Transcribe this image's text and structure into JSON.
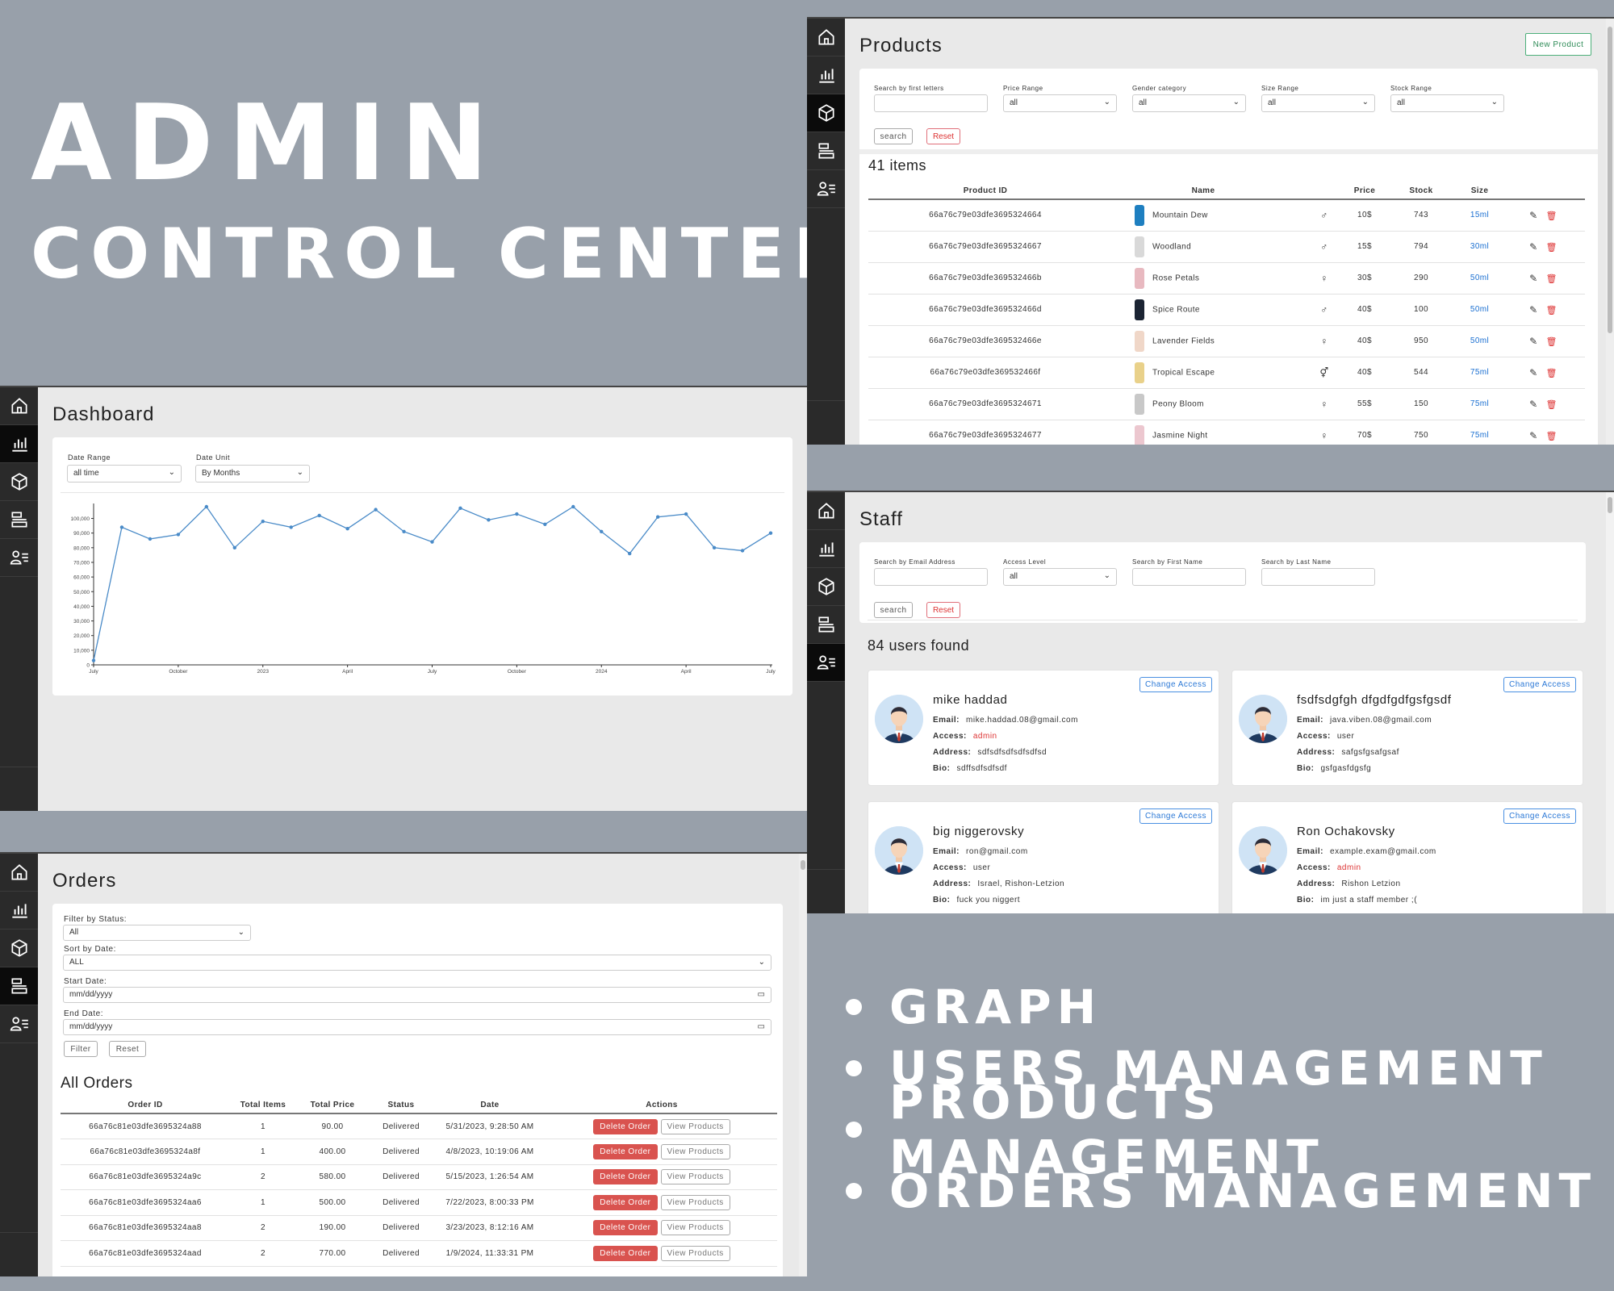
{
  "hero": {
    "title": "ADMIN",
    "subtitle": "CONTROL CENTER"
  },
  "features": [
    "GRAPH",
    "USERS MANAGEMENT",
    "PRODUCTS MANAGEMENT",
    "ORDERS MANAGEMENT"
  ],
  "dashboard": {
    "title": "Dashboard",
    "date_range_label": "Date Range",
    "date_range_value": "all time",
    "date_unit_label": "Date Unit",
    "date_unit_value": "By Months"
  },
  "chart_data": {
    "type": "line",
    "x_tick_labels": [
      "July",
      "October",
      "2023",
      "April",
      "July",
      "October",
      "2024",
      "April",
      "July"
    ],
    "y_tick_labels": [
      "0",
      "10,000",
      "20,000",
      "30,000",
      "40,000",
      "50,000",
      "60,000",
      "70,000",
      "80,000",
      "90,000",
      "100,000"
    ],
    "ylim": [
      0,
      108000
    ],
    "values": [
      3000,
      94000,
      86000,
      89000,
      108000,
      80000,
      98000,
      94000,
      102000,
      93000,
      106000,
      91000,
      84000,
      107000,
      99000,
      103000,
      96000,
      108000,
      91000,
      76000,
      101000,
      103000,
      80000,
      78000,
      90000
    ],
    "color": "#4a8bc8",
    "grid": false
  },
  "products": {
    "title": "Products",
    "new_button": "New Product",
    "filters": [
      {
        "label": "Search by first letters",
        "value": ""
      },
      {
        "label": "Price Range",
        "value": "all"
      },
      {
        "label": "Gender category",
        "value": "all"
      },
      {
        "label": "Size Range",
        "value": "all"
      },
      {
        "label": "Stock Range",
        "value": "all"
      }
    ],
    "search_btn": "search",
    "reset_btn": "Reset",
    "count": "41 items",
    "columns": [
      "Product ID",
      "Name",
      "Price",
      "Stock",
      "Size"
    ],
    "rows": [
      {
        "id": "66a76c79e03dfe3695324664",
        "name": "Mountain Dew",
        "gender": "♂",
        "price": "10$",
        "stock": "743",
        "size": "15ml",
        "color": "#1e7fc0"
      },
      {
        "id": "66a76c79e03dfe3695324667",
        "name": "Woodland",
        "gender": "♂",
        "price": "15$",
        "stock": "794",
        "size": "30ml",
        "color": "#d9d9d9"
      },
      {
        "id": "66a76c79e03dfe369532466b",
        "name": "Rose Petals",
        "gender": "♀",
        "price": "30$",
        "stock": "290",
        "size": "50ml",
        "color": "#e8b9c0"
      },
      {
        "id": "66a76c79e03dfe369532466d",
        "name": "Spice Route",
        "gender": "♂",
        "price": "40$",
        "stock": "100",
        "size": "50ml",
        "color": "#1b2433"
      },
      {
        "id": "66a76c79e03dfe369532466e",
        "name": "Lavender Fields",
        "gender": "♀",
        "price": "40$",
        "stock": "950",
        "size": "50ml",
        "color": "#f0d7c8"
      },
      {
        "id": "66a76c79e03dfe369532466f",
        "name": "Tropical Escape",
        "gender": "⚥",
        "price": "40$",
        "stock": "544",
        "size": "75ml",
        "color": "#e9d18a"
      },
      {
        "id": "66a76c79e03dfe3695324671",
        "name": "Peony Bloom",
        "gender": "♀",
        "price": "55$",
        "stock": "150",
        "size": "75ml",
        "color": "#c8c8c8"
      },
      {
        "id": "66a76c79e03dfe3695324677",
        "name": "Jasmine Night",
        "gender": "♀",
        "price": "70$",
        "stock": "750",
        "size": "75ml",
        "color": "#ecc7cf"
      }
    ]
  },
  "staff": {
    "title": "Staff",
    "filters": [
      {
        "label": "Search by Email Address",
        "value": ""
      },
      {
        "label": "Access Level",
        "value": "all"
      },
      {
        "label": "Search by First Name",
        "value": ""
      },
      {
        "label": "Search by Last Name",
        "value": ""
      }
    ],
    "search_btn": "search",
    "reset_btn": "Reset",
    "count": "84 users found",
    "change_access": "Change Access",
    "field_labels": {
      "email": "Email:",
      "access": "Access:",
      "address": "Address:",
      "bio": "Bio:"
    },
    "users": [
      {
        "name": "mike haddad",
        "email": "mike.haddad.08@gmail.com",
        "access": "admin",
        "address": "sdfsdfsdfsdfsdfsd",
        "bio": "sdffsdfsdfsdf"
      },
      {
        "name": "fsdfsdgfgh dfgdfgdfgsfgsdf",
        "email": "java.viben.08@gmail.com",
        "access": "user",
        "address": "safgsfgsafgsaf",
        "bio": "gsfgasfdgsfg"
      },
      {
        "name": "big niggerovsky",
        "email": "ron@gmail.com",
        "access": "user",
        "address": "Israel, Rishon-Letzion",
        "bio": "fuck you niggert"
      },
      {
        "name": "Ron Ochakovsky",
        "email": "example.exam@gmail.com",
        "access": "admin",
        "address": "Rishon Letzion",
        "bio": "im just a staff member ;("
      }
    ]
  },
  "orders": {
    "title": "Orders",
    "filter_status_label": "Filter by Status:",
    "filter_status_value": "All",
    "sort_label": "Sort by Date:",
    "sort_value": "ALL",
    "start_label": "Start Date:",
    "start_value": "mm/dd/yyyy",
    "end_label": "End Date:",
    "end_value": "mm/dd/yyyy",
    "filter_btn": "Filter",
    "reset_btn": "Reset",
    "section_title": "All Orders",
    "columns": [
      "Order ID",
      "Total Items",
      "Total Price",
      "Status",
      "Date",
      "Actions"
    ],
    "delete_label": "Delete Order",
    "view_label": "View Products",
    "rows": [
      {
        "id": "66a76c81e03dfe3695324a88",
        "items": "1",
        "price": "90.00",
        "status": "Delivered",
        "date": "5/31/2023, 9:28:50 AM"
      },
      {
        "id": "66a76c81e03dfe3695324a8f",
        "items": "1",
        "price": "400.00",
        "status": "Delivered",
        "date": "4/8/2023, 10:19:06 AM"
      },
      {
        "id": "66a76c81e03dfe3695324a9c",
        "items": "2",
        "price": "580.00",
        "status": "Delivered",
        "date": "5/15/2023, 1:26:54 AM"
      },
      {
        "id": "66a76c81e03dfe3695324aa6",
        "items": "1",
        "price": "500.00",
        "status": "Delivered",
        "date": "7/22/2023, 8:00:33 PM"
      },
      {
        "id": "66a76c81e03dfe3695324aa8",
        "items": "2",
        "price": "190.00",
        "status": "Delivered",
        "date": "3/23/2023, 8:12:16 AM"
      },
      {
        "id": "66a76c81e03dfe3695324aad",
        "items": "2",
        "price": "770.00",
        "status": "Delivered",
        "date": "1/9/2024, 11:33:31 PM"
      }
    ]
  },
  "icons": [
    "home-icon",
    "chart-icon",
    "box-icon",
    "orders-icon",
    "staff-icon",
    "logout-icon"
  ]
}
